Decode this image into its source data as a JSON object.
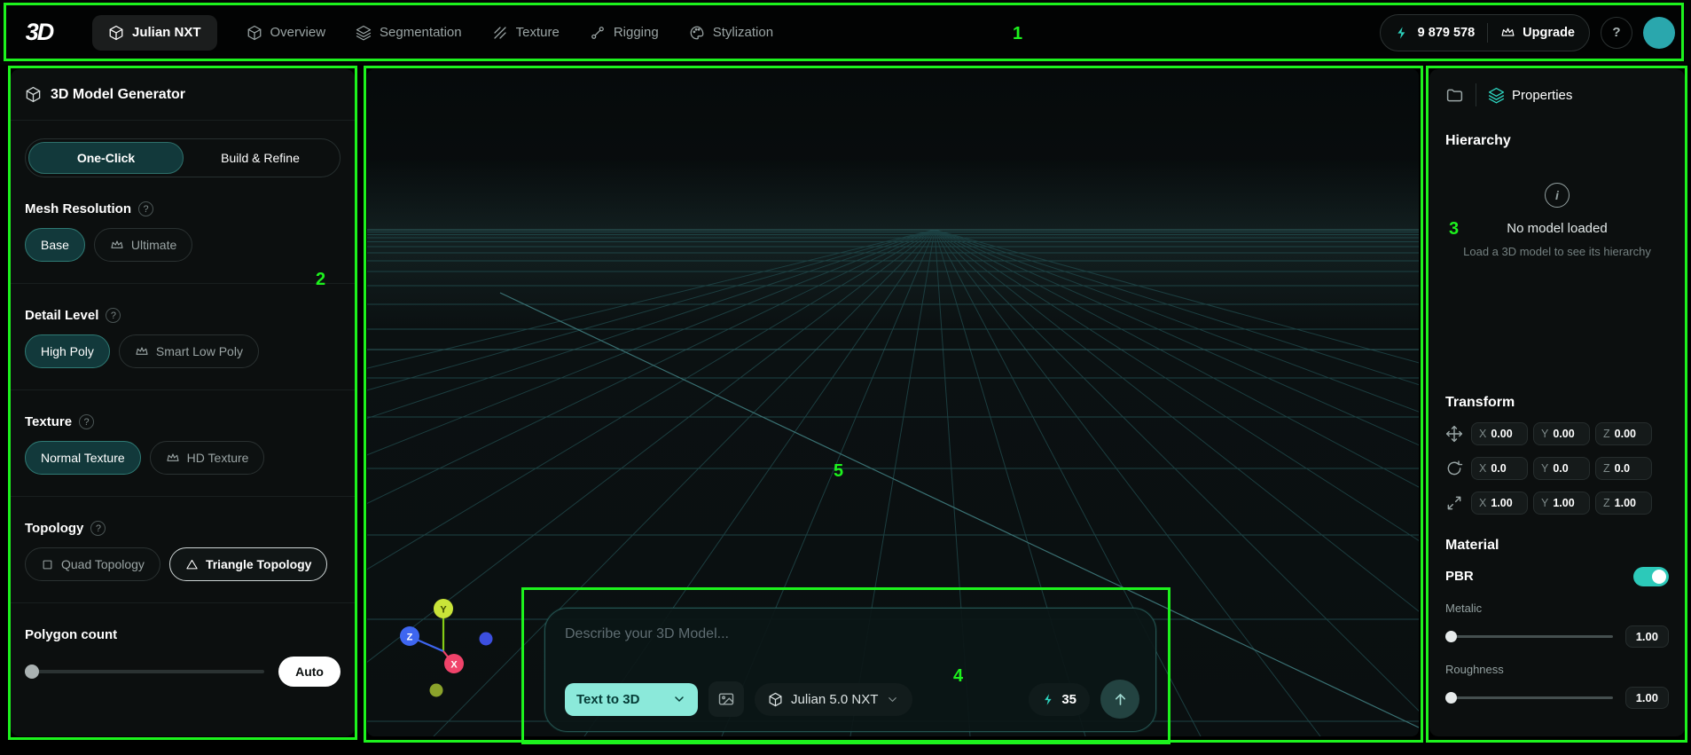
{
  "annotations": {
    "labels": [
      "1",
      "2",
      "3",
      "4",
      "5"
    ]
  },
  "header": {
    "logo": "3D",
    "model_nav": "Julian NXT",
    "nav": [
      {
        "label": "Overview"
      },
      {
        "label": "Segmentation"
      },
      {
        "label": "Texture"
      },
      {
        "label": "Rigging"
      },
      {
        "label": "Stylization"
      }
    ],
    "credits": "9 879 578",
    "upgrade": "Upgrade"
  },
  "glyphs": {
    "help": "?",
    "info": "i"
  },
  "generator": {
    "title": "3D Model Generator",
    "tabs": {
      "one_click": "One-Click",
      "build_refine": "Build & Refine"
    },
    "mesh": {
      "title": "Mesh Resolution",
      "base": "Base",
      "ultimate": "Ultimate"
    },
    "detail": {
      "title": "Detail Level",
      "high": "High Poly",
      "low": "Smart Low Poly"
    },
    "texture": {
      "title": "Texture",
      "normal": "Normal Texture",
      "hd": "HD Texture"
    },
    "topology": {
      "title": "Topology",
      "quad": "Quad Topology",
      "triangle": "Triangle Topology"
    },
    "polygon": {
      "title": "Polygon count",
      "auto": "Auto"
    }
  },
  "viewport": {
    "axis": {
      "x": "X",
      "y": "Y",
      "z": "Z"
    },
    "prompt": {
      "placeholder": "Describe your 3D Model...",
      "mode": "Text to 3D",
      "model": "Julian 5.0 NXT",
      "cost": "35"
    }
  },
  "properties": {
    "tab": "Properties",
    "hierarchy_title": "Hierarchy",
    "empty_title": "No model loaded",
    "empty_subtitle": "Load a 3D model to see its hierarchy",
    "transform": {
      "title": "Transform",
      "rows": [
        {
          "x_label": "X",
          "x": "0.00",
          "y_label": "Y",
          "y": "0.00",
          "z_label": "Z",
          "z": "0.00"
        },
        {
          "x_label": "X",
          "x": "0.0",
          "y_label": "Y",
          "y": "0.0",
          "z_label": "Z",
          "z": "0.0"
        },
        {
          "x_label": "X",
          "x": "1.00",
          "y_label": "Y",
          "y": "1.00",
          "z_label": "Z",
          "z": "1.00"
        }
      ]
    },
    "material": {
      "title": "Material",
      "pbr": "PBR",
      "metalic": "Metalic",
      "metalic_value": "1.00",
      "roughness": "Roughness",
      "roughness_value": "1.00"
    }
  }
}
